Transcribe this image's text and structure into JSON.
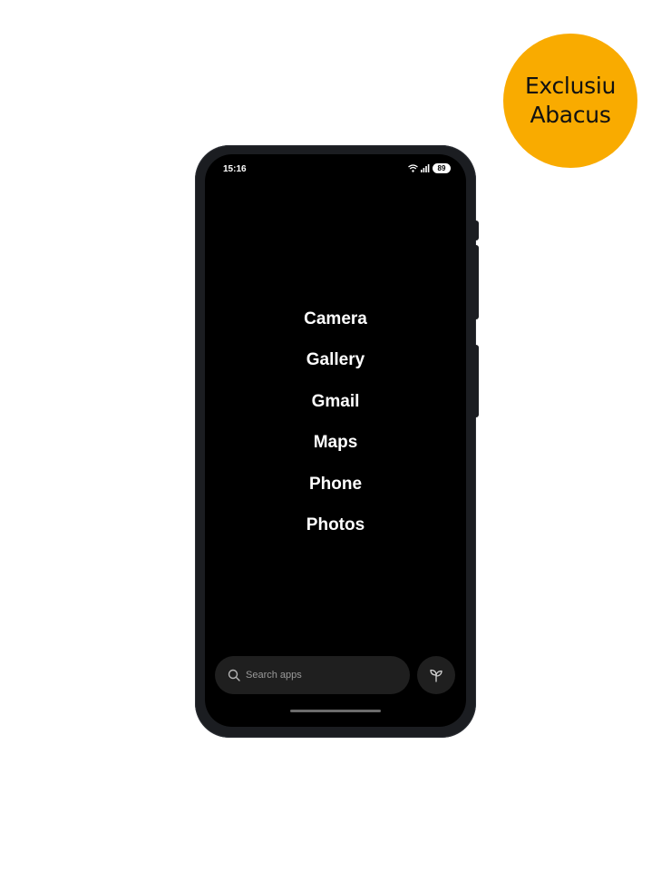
{
  "badge": {
    "line1": "Exclusiu",
    "line2": "Abacus",
    "color": "#f9ab00"
  },
  "status_bar": {
    "time": "15:16",
    "battery": "89",
    "icons": [
      "wifi-icon",
      "signal-icon",
      "battery-icon"
    ]
  },
  "apps": [
    {
      "label": "Camera"
    },
    {
      "label": "Gallery"
    },
    {
      "label": "Gmail"
    },
    {
      "label": "Maps"
    },
    {
      "label": "Phone"
    },
    {
      "label": "Photos"
    }
  ],
  "search": {
    "placeholder": "Search apps",
    "value": "",
    "icon": "search-icon"
  },
  "leaf_button": {
    "icon": "leaf-icon"
  }
}
